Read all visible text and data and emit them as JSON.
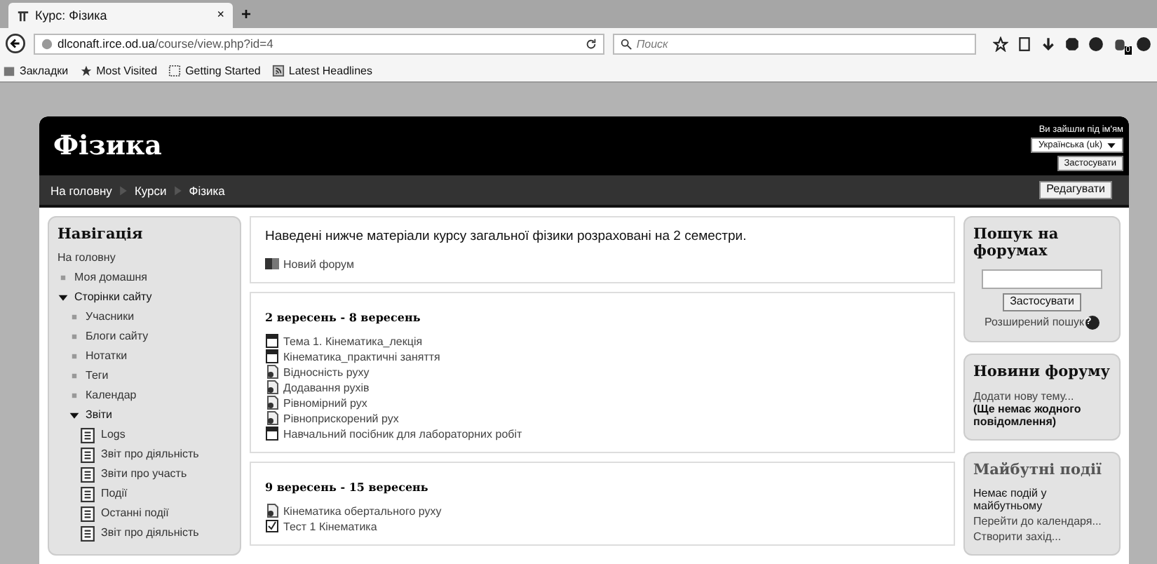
{
  "browser": {
    "tab": {
      "title": "Курс: Фізика",
      "close": "×"
    },
    "new_tab": "+",
    "url": {
      "host": "dlconaft.irce.od.ua",
      "path": "/course/view.php?id=4"
    },
    "search": {
      "placeholder": "Поиск"
    },
    "badge": "0",
    "bookmarks": [
      {
        "label": "Закладки",
        "kind": "folder"
      },
      {
        "label": "Most Visited",
        "kind": "star"
      },
      {
        "label": "Getting Started",
        "kind": "page"
      },
      {
        "label": "Latest Headlines",
        "kind": "feed"
      }
    ]
  },
  "header": {
    "title": "Фізика",
    "login_text": "Ви зайшли під ім'ям",
    "language": "Українська (uk)",
    "apply": "Застосувати"
  },
  "breadcrumbs": [
    "На головну",
    "Курси",
    "Фізика"
  ],
  "edit_button": "Редагувати",
  "navigation": {
    "title": "Навігація",
    "items": [
      {
        "label": "На головну",
        "kind": "link"
      },
      {
        "label": "Моя домашня",
        "kind": "bullet"
      },
      {
        "label": "Сторінки сайту",
        "kind": "branch",
        "expanded": true,
        "children": [
          {
            "label": "Учасники",
            "kind": "bullet"
          },
          {
            "label": "Блоги сайту",
            "kind": "bullet"
          },
          {
            "label": "Нотатки",
            "kind": "bullet"
          },
          {
            "label": "Теги",
            "kind": "bullet"
          },
          {
            "label": "Календар",
            "kind": "bullet"
          },
          {
            "label": "Звіти",
            "kind": "branch",
            "expanded": true,
            "children": [
              {
                "label": "Logs",
                "kind": "report"
              },
              {
                "label": "Звіт про діяльність",
                "kind": "report"
              },
              {
                "label": "Звіти про участь",
                "kind": "report"
              },
              {
                "label": "Події",
                "kind": "report"
              },
              {
                "label": "Останні події",
                "kind": "report"
              },
              {
                "label": "Звіт про діяльність",
                "kind": "report"
              }
            ]
          }
        ]
      }
    ]
  },
  "sections": [
    {
      "summary": "Наведені нижче матеріали курсу загальної фізики розраховані на 2 семестри.",
      "activities": [
        {
          "label": "Новий форум",
          "kind": "forum"
        }
      ]
    },
    {
      "title": "2 вересень - 8 вересень",
      "activities": [
        {
          "label": "Тема 1. Кінематика_лекція",
          "kind": "pdf"
        },
        {
          "label": "Кінематика_практичні заняття",
          "kind": "pdf"
        },
        {
          "label": "Відносність руху",
          "kind": "file"
        },
        {
          "label": "Додавання рухів",
          "kind": "file"
        },
        {
          "label": "Рівномірний рух",
          "kind": "file"
        },
        {
          "label": "Рівноприскорений рух",
          "kind": "file"
        },
        {
          "label": "Навчальний посібник для лабораторних робіт",
          "kind": "pdf"
        }
      ]
    },
    {
      "title": "9 вересень - 15 вересень",
      "activities": [
        {
          "label": "Кінематика обертального руху",
          "kind": "file"
        },
        {
          "label": "Тест 1 Кінематика",
          "kind": "quiz"
        }
      ]
    }
  ],
  "forum_search": {
    "title": "Пошук на форумах",
    "button": "Застосувати",
    "advanced": "Розширений пошук",
    "help": "?"
  },
  "forum_news": {
    "title": "Новини форуму",
    "add": "Додати нову тему...",
    "empty": "(Ще немає жодного повідомлення)"
  },
  "upcoming": {
    "title": "Майбутні події",
    "none": "Немає подій у майбутньому",
    "calendar": "Перейти до календаря...",
    "create": "Створити захід..."
  }
}
